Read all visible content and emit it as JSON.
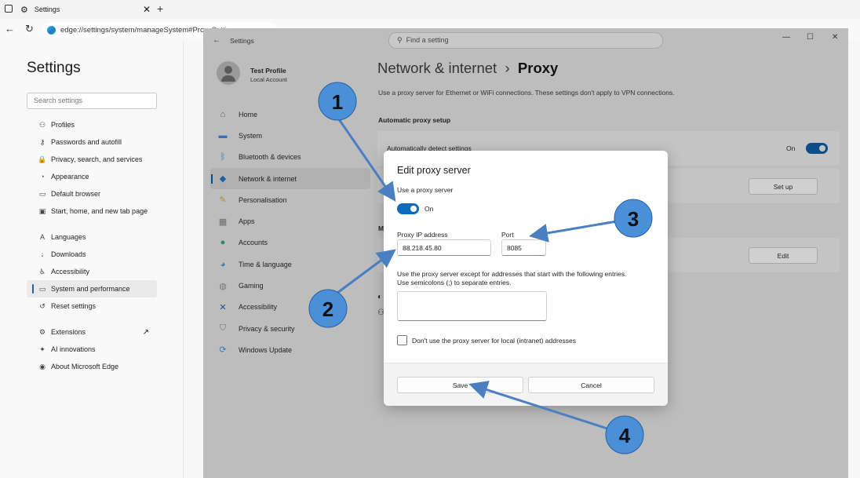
{
  "browser": {
    "tab_title": "Settings",
    "url": "edge://settings/system/manageSystem#ProxySettings"
  },
  "edge_settings": {
    "title": "Settings",
    "search_placeholder": "Search settings",
    "items": [
      {
        "icon": "profiles-icon",
        "glyph": "⚇",
        "label": "Profiles"
      },
      {
        "icon": "key-icon",
        "glyph": "⚷",
        "label": "Passwords and autofill"
      },
      {
        "icon": "lock-icon",
        "glyph": "🔒",
        "label": "Privacy, search, and services"
      },
      {
        "icon": "appearance-icon",
        "glyph": "◔",
        "label": "Appearance"
      },
      {
        "icon": "browser-icon",
        "glyph": "▭",
        "label": "Default browser"
      },
      {
        "icon": "newtab-icon",
        "glyph": "▣",
        "label": "Start, home, and new tab page"
      },
      {
        "icon": "languages-icon",
        "glyph": "A",
        "label": "Languages"
      },
      {
        "icon": "download-icon",
        "glyph": "↓",
        "label": "Downloads"
      },
      {
        "icon": "accessibility-icon",
        "glyph": "♿",
        "label": "Accessibility"
      },
      {
        "icon": "system-icon",
        "glyph": "▭",
        "label": "System and performance"
      },
      {
        "icon": "reset-icon",
        "glyph": "↺",
        "label": "Reset settings"
      },
      {
        "icon": "extensions-icon",
        "glyph": "⚙",
        "label": "Extensions"
      },
      {
        "icon": "ai-icon",
        "glyph": "✦",
        "label": "AI innovations"
      },
      {
        "icon": "edge-icon",
        "glyph": "◉",
        "label": "About Microsoft Edge"
      }
    ]
  },
  "windows_settings": {
    "title": "Settings",
    "search_placeholder": "Find a setting",
    "profile_name": "Test Profile",
    "profile_sub": "Local Account",
    "nav": [
      {
        "icon": "home-icon",
        "glyph": "⌂",
        "label": "Home"
      },
      {
        "icon": "monitor-icon",
        "glyph": "▬",
        "label": "System"
      },
      {
        "icon": "bluetooth-icon",
        "glyph": "ᛒ",
        "label": "Bluetooth & devices"
      },
      {
        "icon": "wifi-icon",
        "glyph": "◆",
        "label": "Network & internet"
      },
      {
        "icon": "brush-icon",
        "glyph": "✎",
        "label": "Personalisation"
      },
      {
        "icon": "apps-icon",
        "glyph": "▦",
        "label": "Apps"
      },
      {
        "icon": "accounts-icon",
        "glyph": "●",
        "label": "Accounts"
      },
      {
        "icon": "globe-clock-icon",
        "glyph": "◕",
        "label": "Time & language"
      },
      {
        "icon": "gamepad-icon",
        "glyph": "◍",
        "label": "Gaming"
      },
      {
        "icon": "accessibility-person-icon",
        "glyph": "✕",
        "label": "Accessibility"
      },
      {
        "icon": "shield-icon",
        "glyph": "⛉",
        "label": "Privacy & security"
      },
      {
        "icon": "update-icon",
        "glyph": "⟳",
        "label": "Windows Update"
      }
    ],
    "breadcrumb_parent": "Network & internet",
    "breadcrumb_sep": "›",
    "breadcrumb_current": "Proxy",
    "description": "Use a proxy server for Ethernet or WiFi connections. These settings don't apply to VPN connections.",
    "auto_section": "Automatic proxy setup",
    "auto_detect_label": "Automatically detect settings",
    "auto_detect_state": "On",
    "setup_button": "Set up",
    "manual_section_initial": "M",
    "edit_button": "Edit"
  },
  "dialog": {
    "title": "Edit proxy server",
    "use_proxy_label": "Use a proxy server",
    "use_proxy_state": "On",
    "ip_label": "Proxy IP address",
    "ip_value": "88.218.45.80",
    "port_label": "Port",
    "port_value": "8085",
    "exceptions_text_1": "Use the proxy server except for addresses that start with the following entries.",
    "exceptions_text_2": "Use semicolons (;) to separate entries.",
    "exceptions_value": "",
    "local_checkbox_label": "Don't use the proxy server for local (intranet) addresses",
    "save_label": "Save",
    "cancel_label": "Cancel"
  },
  "annotations": {
    "badge_color": "#4a90d9",
    "arrow_color": "#4a7fc1",
    "badges": [
      "1",
      "2",
      "3",
      "4"
    ]
  }
}
